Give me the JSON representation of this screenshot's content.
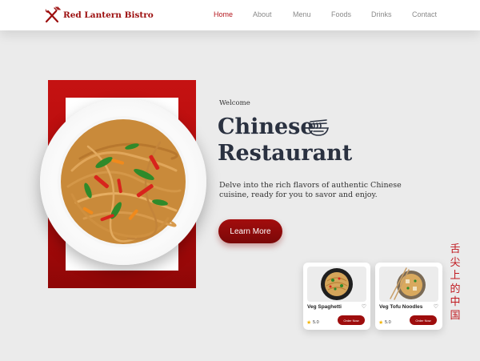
{
  "brand": {
    "name": "Red Lantern Bistro",
    "logo_icon": "fork-and-knife-icon"
  },
  "nav": [
    {
      "label": "Home",
      "active": true
    },
    {
      "label": "About",
      "active": false
    },
    {
      "label": "Menu",
      "active": false
    },
    {
      "label": "Foods",
      "active": false
    },
    {
      "label": "Drinks",
      "active": false
    },
    {
      "label": "Contact",
      "active": false
    }
  ],
  "hero": {
    "welcome": "Welcome",
    "title_line1": "Chinese",
    "title_line2": "Restaurant",
    "title_icon": "noodle-bowl-icon",
    "description": "Delve into the rich flavors of authentic Chinese cuisine, ready for you to savor and enjoy.",
    "cta_label": "Learn More"
  },
  "cards": [
    {
      "name": "Veg Spaghetti",
      "rating": "5.0",
      "order_label": "Order Now"
    },
    {
      "name": "Veg Tofu Noodles",
      "rating": "5.0",
      "order_label": "Order Now"
    }
  ],
  "vertical_text": [
    "舌",
    "尖",
    "上",
    "的",
    "中",
    "国"
  ],
  "colors": {
    "accent": "#b4161d",
    "dark_red": "#8e0707",
    "background": "#ebebeb"
  }
}
